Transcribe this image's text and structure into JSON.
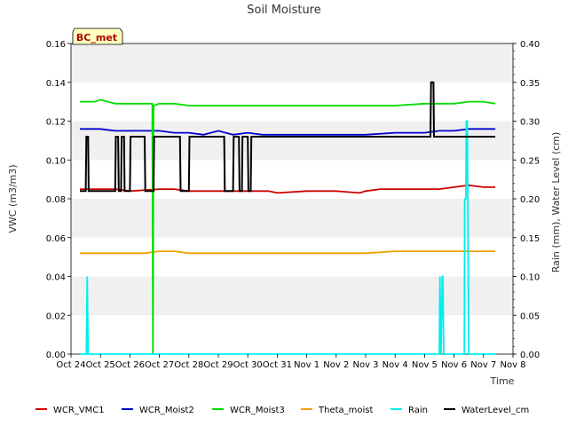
{
  "chart_data": {
    "type": "line",
    "title": "Soil Moisture",
    "site_label": "BC_met",
    "xlabel": "Time",
    "ylabel_left": "VWC (m3/m3)",
    "ylabel_right": "Rain (mm), Water Level (cm)",
    "x_range_days": [
      0,
      15
    ],
    "x_ticks": [
      "Oct 24",
      "Oct 25",
      "Oct 26",
      "Oct 27",
      "Oct 28",
      "Oct 29",
      "Oct 30",
      "Oct 31",
      "Nov 1",
      "Nov 2",
      "Nov 3",
      "Nov 4",
      "Nov 5",
      "Nov 6",
      "Nov 7",
      "Nov 8"
    ],
    "ylim_left": [
      0,
      0.16
    ],
    "yticks_left": [
      "0.00",
      "0.02",
      "0.04",
      "0.06",
      "0.08",
      "0.10",
      "0.12",
      "0.14",
      "0.16"
    ],
    "ylim_right": [
      0,
      0.4
    ],
    "yticks_right": [
      "0.00",
      "0.05",
      "0.10",
      "0.15",
      "0.20",
      "0.25",
      "0.30",
      "0.35",
      "0.40"
    ],
    "colors": {
      "WCR_VMC1": "#cc0000",
      "WCR_Moist2": "#0000cc",
      "WCR_Moist3": "#00dd00",
      "Theta_moist": "#f0a000",
      "Rain": "#00eeee",
      "WaterLevel_cm": "#000000"
    },
    "series": [
      {
        "name": "WCR_VMC1",
        "axis": "left",
        "x": [
          0.3,
          1.0,
          1.5,
          2.0,
          3.0,
          3.5,
          4.0,
          5.0,
          6.0,
          6.7,
          7.0,
          8.0,
          9.0,
          9.8,
          10.0,
          10.5,
          11.0,
          12.0,
          12.5,
          13.0,
          13.5,
          14.0,
          14.4
        ],
        "y": [
          0.085,
          0.085,
          0.085,
          0.084,
          0.085,
          0.085,
          0.084,
          0.084,
          0.084,
          0.084,
          0.083,
          0.084,
          0.084,
          0.083,
          0.084,
          0.085,
          0.085,
          0.085,
          0.085,
          0.086,
          0.087,
          0.086,
          0.086
        ]
      },
      {
        "name": "WCR_Moist2",
        "axis": "left",
        "x": [
          0.3,
          1.0,
          1.5,
          2.0,
          3.0,
          3.5,
          4.0,
          4.5,
          5.0,
          5.5,
          6.0,
          6.5,
          7.0,
          7.5,
          8.0,
          9.0,
          10.0,
          11.0,
          12.0,
          12.5,
          13.0,
          13.5,
          14.0,
          14.4
        ],
        "y": [
          0.116,
          0.116,
          0.115,
          0.115,
          0.115,
          0.114,
          0.114,
          0.113,
          0.115,
          0.113,
          0.114,
          0.113,
          0.113,
          0.113,
          0.113,
          0.113,
          0.113,
          0.114,
          0.114,
          0.115,
          0.115,
          0.116,
          0.116,
          0.116
        ]
      },
      {
        "name": "WCR_Moist3",
        "axis": "left",
        "x": [
          0.3,
          0.8,
          1.0,
          1.5,
          2.0,
          2.5,
          2.76,
          2.78,
          2.8,
          2.82,
          3.0,
          3.5,
          4.0,
          5.0,
          6.0,
          7.0,
          8.0,
          9.0,
          10.0,
          11.0,
          12.0,
          12.5,
          13.0,
          13.5,
          14.0,
          14.4
        ],
        "y": [
          0.13,
          0.13,
          0.131,
          0.129,
          0.129,
          0.129,
          0.129,
          0.0,
          0.128,
          0.128,
          0.129,
          0.129,
          0.128,
          0.128,
          0.128,
          0.128,
          0.128,
          0.128,
          0.128,
          0.128,
          0.129,
          0.129,
          0.129,
          0.13,
          0.13,
          0.129
        ],
        "note_spike": "drop to 0 near Oct 27"
      },
      {
        "name": "Theta_moist",
        "axis": "left",
        "x": [
          0.3,
          1.0,
          2.0,
          2.5,
          3.0,
          3.5,
          4.0,
          5.0,
          6.0,
          7.0,
          8.0,
          9.0,
          10.0,
          11.0,
          12.0,
          13.0,
          14.0,
          14.4
        ],
        "y": [
          0.052,
          0.052,
          0.052,
          0.052,
          0.053,
          0.053,
          0.052,
          0.052,
          0.052,
          0.052,
          0.052,
          0.052,
          0.052,
          0.053,
          0.053,
          0.053,
          0.053,
          0.053
        ]
      },
      {
        "name": "Rain",
        "axis": "right",
        "x": [
          0.3,
          0.52,
          0.55,
          0.58,
          12.4,
          12.5,
          12.52,
          12.55,
          12.56,
          12.6,
          12.62,
          12.65,
          13.3,
          13.35,
          13.36,
          13.4,
          13.42,
          13.45,
          13.5,
          13.52,
          13.55,
          14.4
        ],
        "y": [
          0.0,
          0.0,
          0.1,
          0.0,
          0.0,
          0.0,
          0.1,
          0.0,
          0.0,
          0.1,
          0.1,
          0.0,
          0.0,
          0.0,
          0.2,
          0.2,
          0.3,
          0.3,
          0.0,
          0.0,
          0.0,
          0.0
        ]
      },
      {
        "name": "WaterLevel_cm",
        "axis": "right",
        "x": [
          0.3,
          0.5,
          0.52,
          0.58,
          0.6,
          1.5,
          1.52,
          1.6,
          1.62,
          1.7,
          1.72,
          1.8,
          1.82,
          2.0,
          2.02,
          2.5,
          2.52,
          2.8,
          2.82,
          3.0,
          3.02,
          3.7,
          3.72,
          4.0,
          4.02,
          5.2,
          5.22,
          5.5,
          5.52,
          5.7,
          5.72,
          5.8,
          5.82,
          6.0,
          6.02,
          6.1,
          6.12,
          12.2,
          12.22,
          12.3,
          12.32,
          14.4
        ],
        "y": [
          0.21,
          0.21,
          0.28,
          0.28,
          0.21,
          0.21,
          0.28,
          0.28,
          0.21,
          0.21,
          0.28,
          0.28,
          0.21,
          0.21,
          0.28,
          0.28,
          0.21,
          0.21,
          0.28,
          0.28,
          0.28,
          0.28,
          0.21,
          0.21,
          0.28,
          0.28,
          0.21,
          0.21,
          0.28,
          0.28,
          0.21,
          0.21,
          0.28,
          0.28,
          0.21,
          0.21,
          0.28,
          0.28,
          0.35,
          0.35,
          0.28,
          0.28
        ]
      }
    ],
    "legend": {
      "placement": "bottom",
      "entries": [
        "WCR_VMC1",
        "WCR_Moist2",
        "WCR_Moist3",
        "Theta_moist",
        "Rain",
        "WaterLevel_cm"
      ]
    }
  }
}
